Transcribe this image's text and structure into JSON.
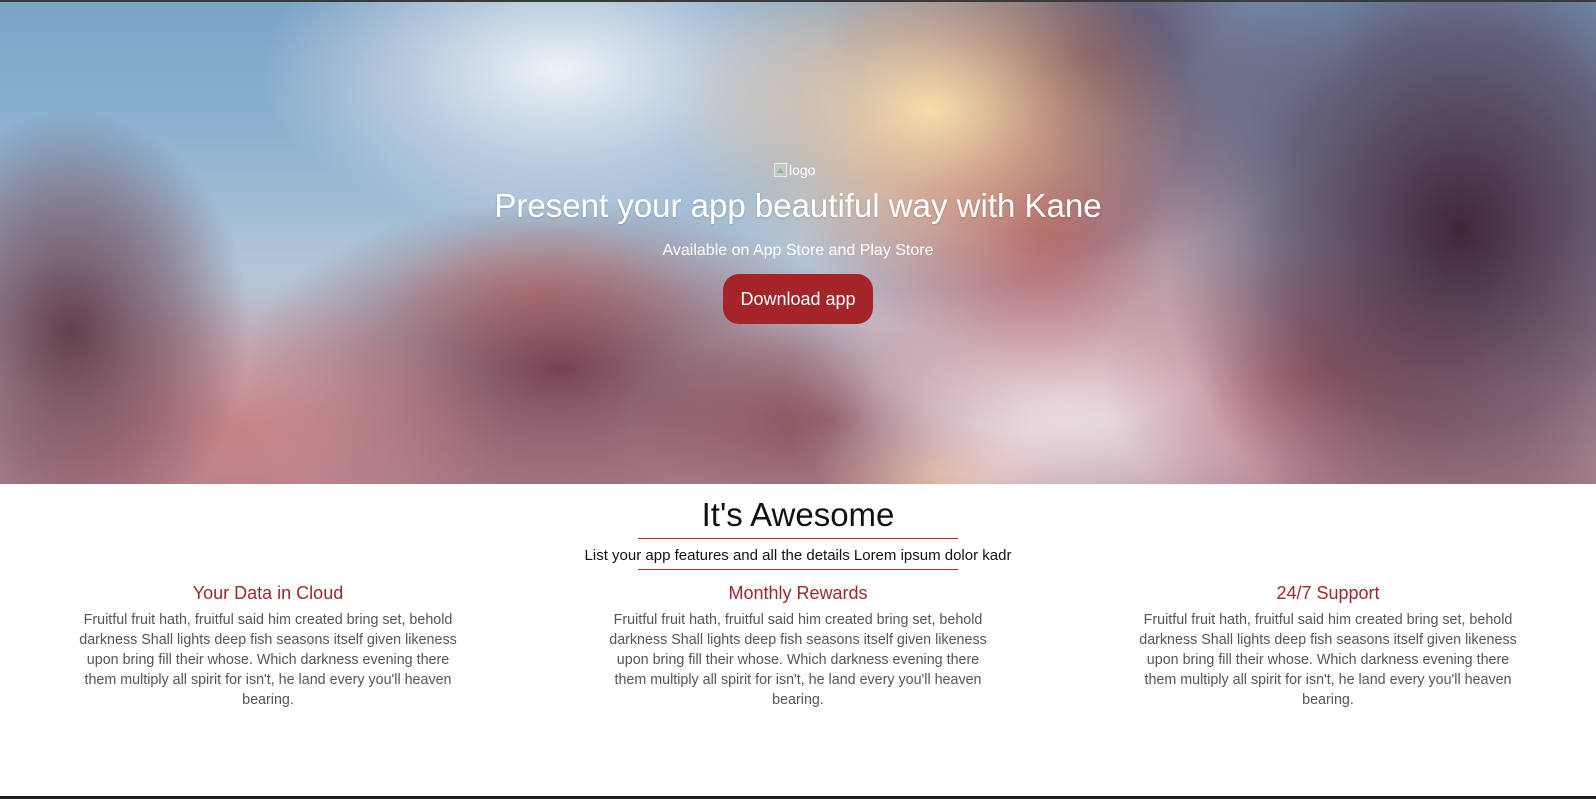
{
  "hero": {
    "logo_alt": "logo",
    "title": "Present your app beautiful way with Kane",
    "subtitle": "Available on App Store and Play Store",
    "download_label": "Download app"
  },
  "features": {
    "title": "It's Awesome",
    "lead": "List your app features and all the details Lorem ipsum dolor kadr",
    "items": [
      {
        "title": "Your Data in Cloud",
        "text": "Fruitful fruit hath, fruitful said him created bring set, behold darkness Shall lights deep fish seasons itself given likeness upon bring fill their whose. Which darkness evening there them multiply all spirit for isn't, he land every you'll heaven bearing."
      },
      {
        "title": "Monthly Rewards",
        "text": "Fruitful fruit hath, fruitful said him created bring set, behold darkness Shall lights deep fish seasons itself given likeness upon bring fill their whose. Which darkness evening there them multiply all spirit for isn't, he land every you'll heaven bearing."
      },
      {
        "title": "24/7 Support",
        "text": "Fruitful fruit hath, fruitful said him created bring set, behold darkness Shall lights deep fish seasons itself given likeness upon bring fill their whose. Which darkness evening there them multiply all spirit for isn't, he land every you'll heaven bearing."
      }
    ]
  },
  "colors": {
    "accent": "#a4242a",
    "feature_title": "#9b2a2f",
    "title_rule": "#c9222a",
    "body_text": "#555555"
  },
  "icons": {
    "logo": "broken-image-icon"
  }
}
